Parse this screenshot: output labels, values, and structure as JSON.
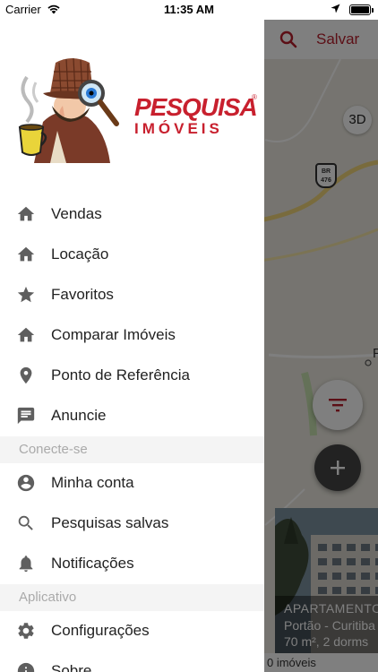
{
  "status_bar": {
    "carrier": "Carrier",
    "time": "11:35 AM"
  },
  "map_screen": {
    "save_label": "Salvar",
    "three_d_label": "3D",
    "road_badge": "BR 476",
    "place_label_fragment": "P",
    "listing_card": {
      "type": "APARTAMENTO",
      "location": "Portão - Curitiba",
      "details": "70 m², 2 dorms"
    },
    "result_count_label": "0 imóveis"
  },
  "brand": {
    "name": "PESQUISA",
    "registered": "®",
    "subtitle": "IMÓVEIS"
  },
  "menu": {
    "main_items": [
      {
        "label": "Vendas",
        "icon": "home-icon"
      },
      {
        "label": "Locação",
        "icon": "home-icon"
      },
      {
        "label": "Favoritos",
        "icon": "star-icon"
      },
      {
        "label": "Comparar Imóveis",
        "icon": "home-icon"
      },
      {
        "label": "Ponto de Referência",
        "icon": "location-pin-icon"
      },
      {
        "label": "Anuncie",
        "icon": "message-icon"
      }
    ],
    "connect_section": {
      "title": "Conecte-se",
      "items": [
        {
          "label": "Minha conta",
          "icon": "account-icon"
        },
        {
          "label": "Pesquisas salvas",
          "icon": "search-icon"
        },
        {
          "label": "Notificações",
          "icon": "bell-icon"
        }
      ]
    },
    "app_section": {
      "title": "Aplicativo",
      "items": [
        {
          "label": "Configurações",
          "icon": "gear-icon"
        },
        {
          "label": "Sobre",
          "icon": "info-icon"
        }
      ]
    }
  },
  "colors": {
    "brand_red": "#c8202e",
    "menu_icon": "#5f5f5f",
    "section_bg": "#f4f4f4"
  }
}
